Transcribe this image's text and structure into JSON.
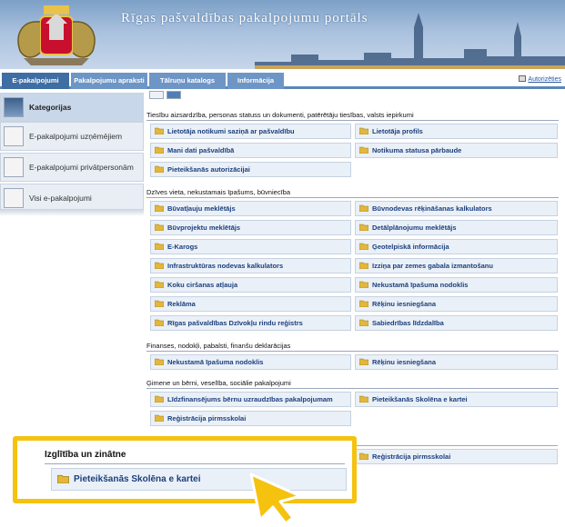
{
  "banner": {
    "title": "Rīgas pašvaldības pakalpojumu portāls"
  },
  "nav": {
    "tabs": [
      {
        "label": "E-pakalpojumi"
      },
      {
        "label": "Pakalpojumu apraksti"
      },
      {
        "label": "Tālruņu katalogs"
      },
      {
        "label": "Informācija"
      }
    ],
    "login_label": "Autorizēties"
  },
  "sidebar": {
    "items": [
      {
        "label": "Kategorijas"
      },
      {
        "label": "E-pakalpojumi uzņēmējiem"
      },
      {
        "label": "E-pakalpojumi privātpersonām"
      },
      {
        "label": "Visi e-pakalpojumi"
      }
    ]
  },
  "categories": [
    {
      "title": "Tiesību aizsardzība, personas statuss un dokumenti, patērētāju tiesības, valsts iepirkumi",
      "rows": [
        [
          "Lietotāja notikumi saziņā ar pašvaldību",
          "Lietotāja profils"
        ],
        [
          "Mani dati pašvaldībā",
          "Notikuma statusa pārbaude"
        ],
        [
          "Pieteikšanās autorizācijai",
          ""
        ]
      ]
    },
    {
      "title": "Dzīves vieta, nekustamais īpašums, būvniecība",
      "rows": [
        [
          "Būvatļauju meklētājs",
          "Būvnodevas rēķināšanas kalkulators"
        ],
        [
          "Būvprojektu meklētājs",
          "Detālplānojumu meklētājs"
        ],
        [
          "E-Karogs",
          "Ģeotelpiskā informācija"
        ],
        [
          "Infrastruktūras nodevas kalkulators",
          "Izziņa par zemes gabala izmantošanu"
        ],
        [
          "Koku ciršanas atļauja",
          "Nekustamā īpašuma nodoklis"
        ],
        [
          "Reklāma",
          "Rēķinu iesniegšana"
        ],
        [
          "Rīgas pašvaldības Dzīvokļu rindu reģistrs",
          "Sabiedrības līdzdalība"
        ]
      ]
    },
    {
      "title": "Finanses, nodokļi, pabalsti, finanšu deklarācijas",
      "rows": [
        [
          "Nekustamā īpašuma nodoklis",
          "Rēķinu iesniegšana"
        ]
      ]
    },
    {
      "title": "Ģimene un bērni, veselība, sociālie pakalpojumi",
      "rows": [
        [
          "Līdzfinansējums bērnu uzraudzības pakalpojumam",
          "Pieteikšanās Skolēna e kartei"
        ],
        [
          "Reģistrācija pirmsskolai",
          ""
        ]
      ]
    }
  ],
  "education_row_right": "Reģistrācija pirmsskolai",
  "callout": {
    "title": "Izglītība un zinātne",
    "item": "Pieteikšanās Skolēna e kartei"
  },
  "colors": {
    "accent": "#f5c20f",
    "nav": "#6d96c6",
    "nav_active": "#3e6ea3",
    "link": "#1c3f7e"
  }
}
